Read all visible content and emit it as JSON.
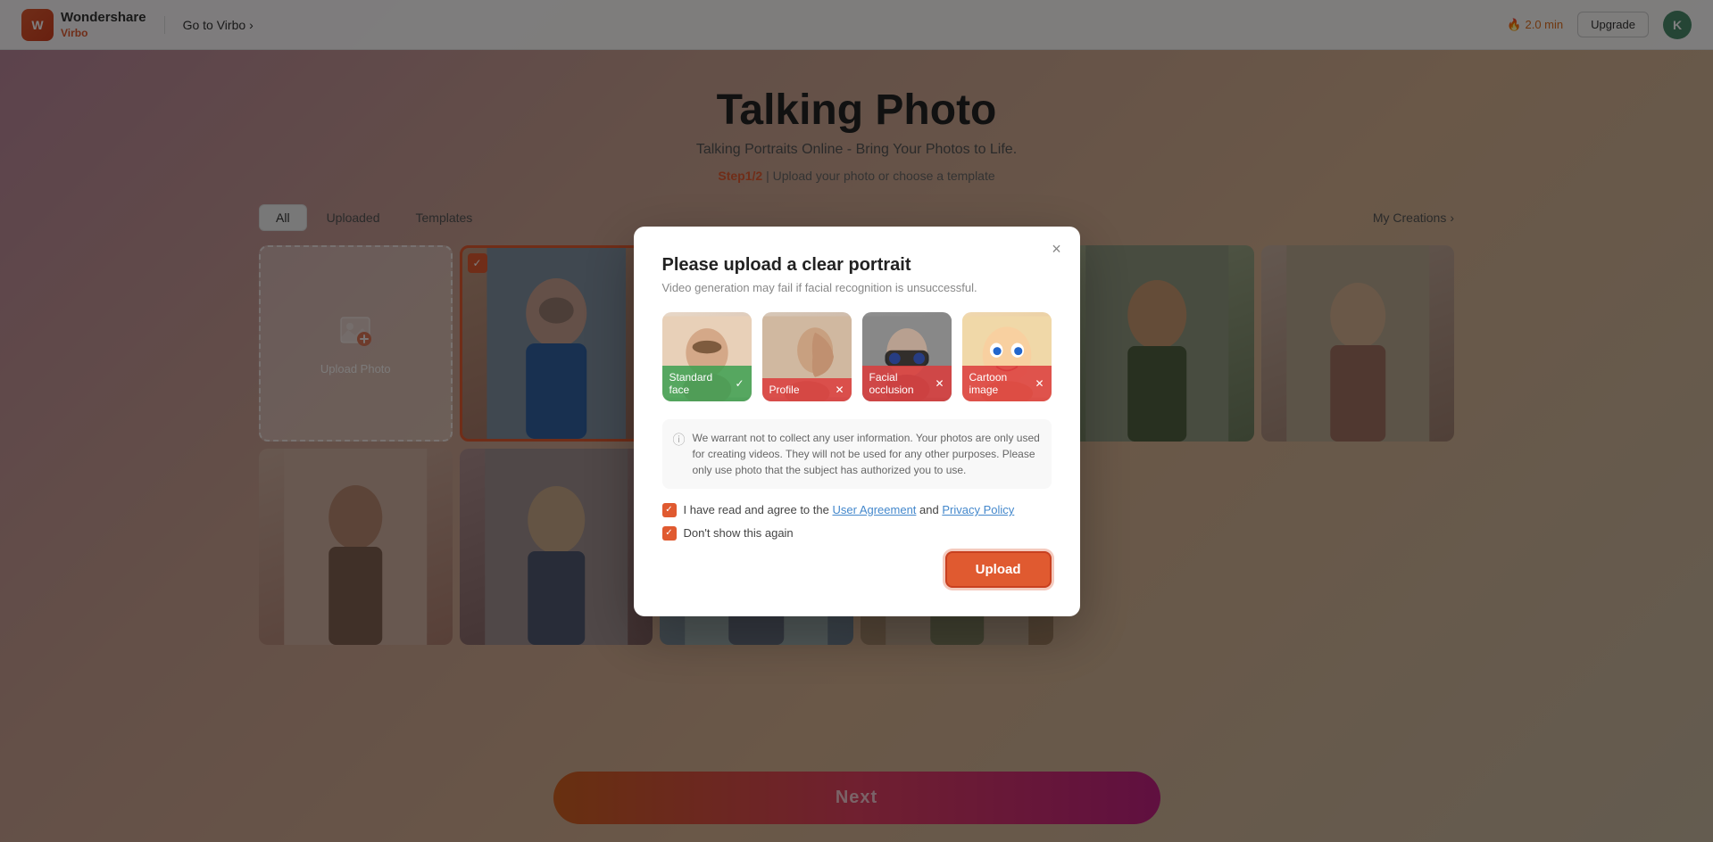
{
  "app": {
    "logo_text": "Wondershare",
    "logo_sub": "Virbo",
    "go_to_virbo": "Go to Virbo",
    "time_label": "2.0 min",
    "upgrade_label": "Upgrade",
    "avatar_letter": "K"
  },
  "page": {
    "title": "Talking Photo",
    "subtitle": "Talking Portraits Online - Bring Your Photos to Life.",
    "step_label": "Step1/2",
    "step_description": "Upload your photo or choose a template"
  },
  "filters": {
    "all_label": "All",
    "uploaded_label": "Uploaded",
    "templates_label": "Templates",
    "my_creations_label": "My Creations"
  },
  "grid": {
    "upload_label": "Upload Photo",
    "items": [
      {
        "id": 1,
        "type": "selected",
        "label": ""
      },
      {
        "id": 2,
        "type": "portrait"
      },
      {
        "id": 3,
        "type": "portrait"
      },
      {
        "id": 4,
        "type": "portrait"
      },
      {
        "id": 5,
        "type": "portrait"
      },
      {
        "id": 6,
        "type": "portrait"
      },
      {
        "id": 7,
        "type": "portrait"
      },
      {
        "id": 8,
        "type": "portrait"
      },
      {
        "id": 9,
        "type": "portrait"
      },
      {
        "id": 10,
        "type": "portrait"
      }
    ]
  },
  "next_button": {
    "label": "Next"
  },
  "modal": {
    "title": "Please upload a clear portrait",
    "subtitle": "Video generation may fail if facial recognition is unsuccessful.",
    "portrait_examples": [
      {
        "label": "Standard face",
        "status": "ok",
        "icon": "✓"
      },
      {
        "label": "Profile",
        "status": "bad",
        "icon": "✕"
      },
      {
        "label": "Facial occlusion",
        "status": "bad",
        "icon": "✕"
      },
      {
        "label": "Cartoon image",
        "status": "bad",
        "icon": "✕"
      }
    ],
    "disclaimer_text": "We warrant not to collect any user information. Your photos are only used for creating videos. They will not be used for any other purposes. Please only use photo that the subject has authorized you to use.",
    "agreement_label": "I have read and agree to the",
    "user_agreement_link": "User Agreement",
    "and_text": "and",
    "privacy_policy_link": "Privacy Policy",
    "dont_show_label": "Don't show this again",
    "upload_button_label": "Upload",
    "close_icon": "×"
  }
}
